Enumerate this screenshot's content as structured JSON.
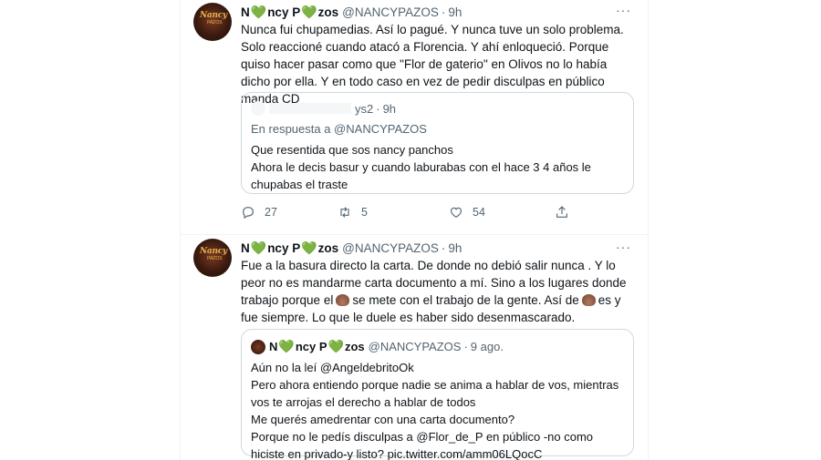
{
  "tweet1": {
    "name_pre": "N",
    "name_post": "ncy P",
    "name_tail": "zos",
    "handle": "@NANCYPAZOS",
    "time": "9h",
    "avatar_text": "NancyPazos",
    "more": "···",
    "text": "Nunca fui chupamedias. Así lo pagué. Y nunca tuve un solo problema. Solo reaccioné cuando atacó a Florencia. Y ahí enloqueció. Porque quiso hacer pasar como que \"Flor de gaterio\" en Olivos no lo había dicho por ella. Y en todo caso en vez de pedir disculpas en público manda CD",
    "quote": {
      "handle_tail": "ys2",
      "time": "9h",
      "reply_to": "En respuesta a @NANCYPAZOS",
      "line1": "Que resentida que sos nancy panchos",
      "line2": "Ahora le decis basur  y cuando laburabas con el hace 3 4 años  le chupabas el traste"
    },
    "actions": {
      "replies": "27",
      "retweets": "5",
      "likes": "54"
    }
  },
  "tweet2": {
    "name_pre": "N",
    "name_mid": "ncy P",
    "name_tail": "zos",
    "handle": "@NANCYPAZOS",
    "time": "9h",
    "avatar_text": "NancyPazos",
    "more": "···",
    "text_a": "Fue a la basura directo la carta. De donde no debió salir nunca . Y lo peor no es mandarme carta documento a mí. Sino a los lugares donde trabajo porque el",
    "text_b": "se mete con el trabajo de la gente. Así de",
    "text_c": "es y fue siempre. Lo que le duele es haber sido desenmascarado.",
    "quote": {
      "name_pre": "N",
      "name_mid": "ncy P",
      "name_tail": "zos",
      "handle": "@NANCYPAZOS",
      "time": "9 ago.",
      "lines": [
        "Aún no la leí @AngeldebritoOk",
        "Pero ahora entiendo porque nadie se anima a hablar de vos, mientras vos te arrojas el derecho a hablar de todos",
        "Me querés amedrentar con una carta documento?",
        "Porque no le pedís disculpas a @Flor_de_P en público -no como hiciste en privado-y listo? pic.twitter.com/amm06LQocC"
      ]
    }
  },
  "colors": {
    "heart": "#5aa83c",
    "muted": "#536471",
    "border": "#cfd9de"
  },
  "icons": [
    "reply-icon",
    "retweet-icon",
    "like-icon",
    "share-icon",
    "more-icon",
    "heart-icon",
    "poop-emoji"
  ]
}
